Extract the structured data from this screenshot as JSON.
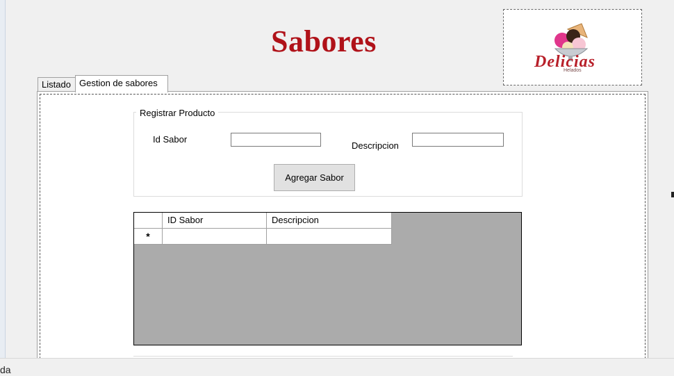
{
  "page": {
    "title": "Sabores"
  },
  "logo": {
    "brand": "Delicias",
    "subtitle": "Helados",
    "icon": "ice-cream-bowl-icon"
  },
  "tabs": [
    {
      "label": "Listado",
      "active": false
    },
    {
      "label": "Gestion de sabores",
      "active": true
    }
  ],
  "form": {
    "group_title": "Registrar Producto",
    "id_label": "Id Sabor",
    "id_value": "",
    "desc_label": "Descripcion",
    "desc_value": "",
    "submit_label": "Agregar Sabor"
  },
  "grid": {
    "columns": [
      "ID Sabor",
      "Descripcion"
    ],
    "new_row_marker": "*",
    "rows": []
  },
  "status": {
    "text": "da"
  },
  "colors": {
    "title": "#b01219",
    "grid_background": "#ababab"
  }
}
